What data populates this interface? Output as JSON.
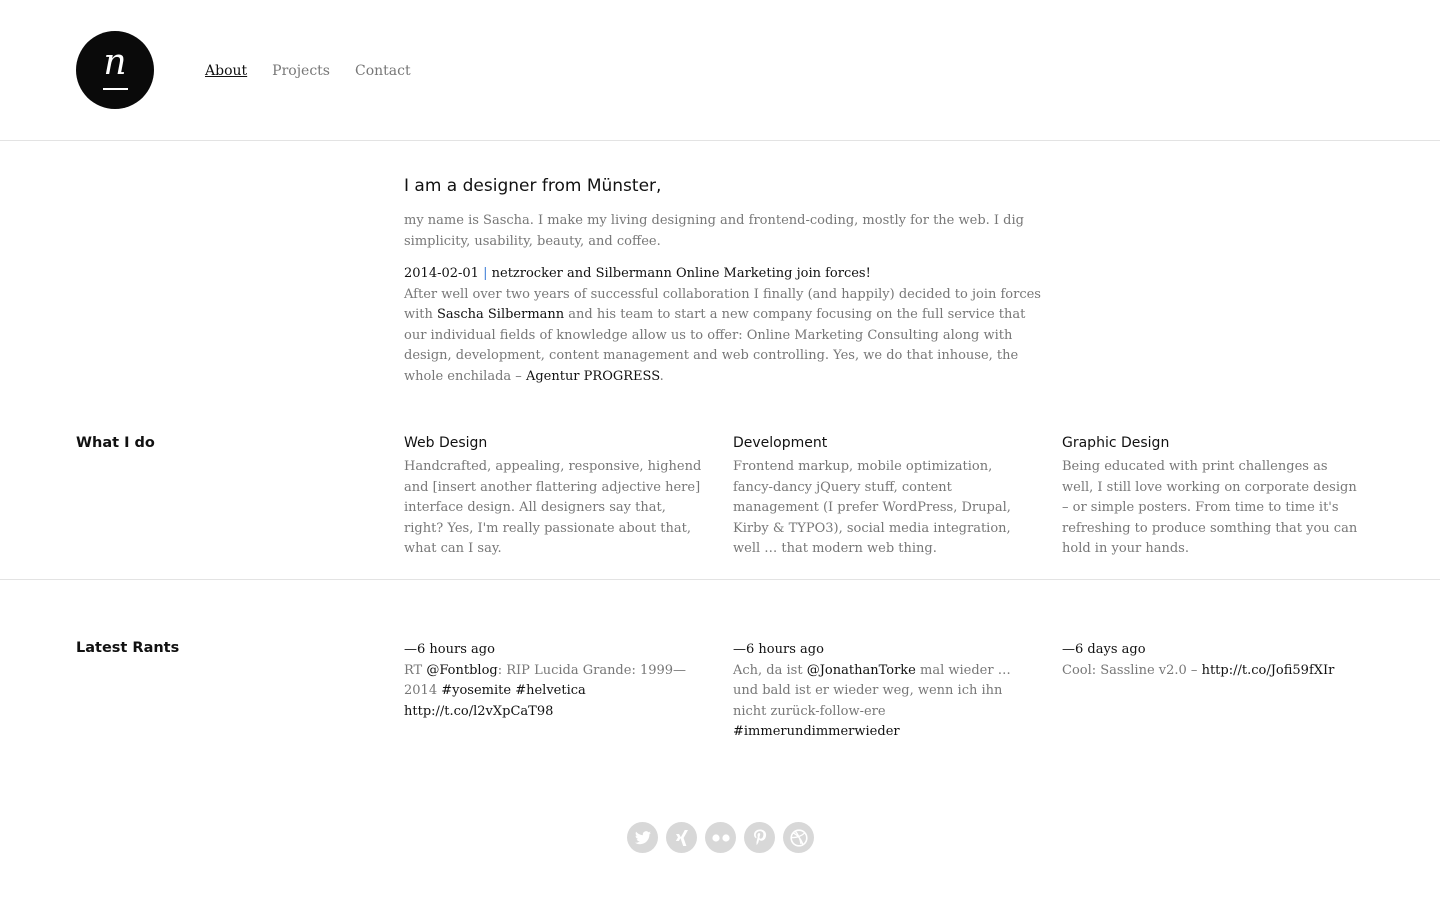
{
  "logo": {
    "letter": "n"
  },
  "nav": {
    "items": [
      "About",
      "Projects",
      "Contact"
    ]
  },
  "intro": {
    "heading": "I am a designer from Münster,",
    "lead": "my name is Sascha. I make my living designing and frontend-coding, mostly for the web. I dig simplicity, usability, beauty, and coffee.",
    "news": {
      "date": "2014-02-01",
      "separator": "|",
      "title": "netzrocker and Silbermann Online Marketing join forces!",
      "body_1": "After well over two years of successful collaboration I finally (and happily) decided to join forces with ",
      "link_1": "Sascha Silbermann",
      "body_2": " and his team to start a new company focusing on the full service that our individual fields of knowledge allow us to offer: Online Marketing Consulting along with design, development, content management and web controlling. Yes, we do that inhouse, the whole enchilada – ",
      "link_2": "Agentur PROGRESS",
      "body_3": "."
    }
  },
  "what_i_do": {
    "label": "What I do",
    "items": [
      {
        "title": "Web Design",
        "text": "Handcrafted, appealing, responsive, highend and [insert another flattering adjective here] interface design. All designers say that, right? Yes, I'm really passionate about that, what can I say."
      },
      {
        "title": "Development",
        "text": "Frontend markup, mobile optimization, fancy-dancy jQuery stuff, content management (I prefer WordPress, Drupal, Kirby & TYPO3), social media integration, well … that modern web thing."
      },
      {
        "title": "Graphic Design",
        "text": "Being educated with print challenges as well, I still love working on corporate design – or simple posters. From time to time it's refreshing to produce somthing that you can hold in your hands."
      }
    ]
  },
  "rants": {
    "label": "Latest Rants",
    "tweets": [
      {
        "ago": "—6 hours ago",
        "pre": "RT ",
        "mention": "@Fontblog",
        "text": ": RIP Lucida Grande: 1999—2014 ",
        "tag1": "#yosemite",
        "space": " ",
        "tag2": "#helvetica",
        "space2": " ",
        "link": "http://t.co/l2vXpCaT98"
      },
      {
        "ago": "—6 hours ago",
        "pre": "Ach, da ist ",
        "mention": "@JonathanTorke",
        "text": " mal wieder … und bald ist er wieder weg, wenn ich ihn nicht zurück-follow-ere ",
        "tag1": "#immerundimmerwieder"
      },
      {
        "ago": "—6 days ago",
        "pre": "Cool: Sassline v2.0 – ",
        "link": "http://t.co/Jofi59fXIr"
      }
    ]
  },
  "social": {
    "icons": [
      "twitter-icon",
      "xing-icon",
      "flickr-icon",
      "pinterest-icon",
      "dribbble-icon"
    ],
    "color": "#d8d8d8"
  }
}
